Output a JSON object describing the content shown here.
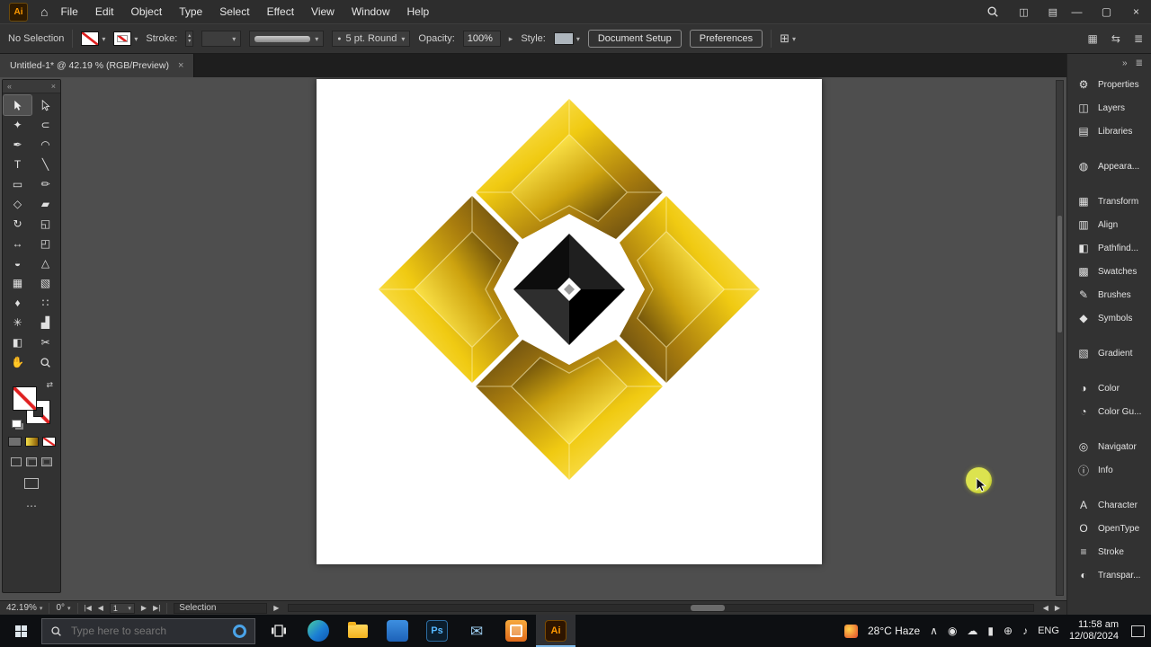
{
  "ui": {
    "chevron_down": "▾",
    "chevron_right": "▸",
    "grip": "᎒᎒"
  },
  "menu_bar": {
    "app_badge": "Ai",
    "home_icon": "⌂",
    "menus": [
      "File",
      "Edit",
      "Object",
      "Type",
      "Select",
      "Effect",
      "View",
      "Window",
      "Help"
    ],
    "arrange_icon": "◫",
    "workspace_icon": "▤",
    "minimize": "—",
    "restore": "▢",
    "close": "×"
  },
  "control_bar": {
    "selection_status": "No Selection",
    "stroke_label": "Stroke:",
    "spinner_up": "▴",
    "spinner_down": "▾",
    "brush_preset_bullet": "●",
    "brush_preset": "5 pt. Round",
    "opacity_label": "Opacity:",
    "opacity_value": "100%",
    "style_label": "Style:",
    "document_setup": "Document Setup",
    "preferences": "Preferences",
    "align_icon": "⊞",
    "right_icons": {
      "grid": "▦",
      "swap": "⇆",
      "menu": "≣"
    }
  },
  "document_tab": {
    "title": "Untitled-1* @ 42.19 % (RGB/Preview)",
    "close": "×"
  },
  "tools_panel": {
    "collapse_icon": "«",
    "close_icon": "×",
    "swap_icon": "⇄",
    "ellipsis": "⋯",
    "tools": [
      {
        "name": "selection",
        "glyph": ""
      },
      {
        "name": "direct-selection",
        "glyph": ""
      },
      {
        "name": "magic-wand",
        "glyph": "✦"
      },
      {
        "name": "lasso",
        "glyph": "⊂"
      },
      {
        "name": "pen",
        "glyph": "✒"
      },
      {
        "name": "curvature",
        "glyph": "◠"
      },
      {
        "name": "type",
        "glyph": "T"
      },
      {
        "name": "line-segment",
        "glyph": "╲"
      },
      {
        "name": "rectangle",
        "glyph": "▭"
      },
      {
        "name": "paintbrush",
        "glyph": "✏"
      },
      {
        "name": "shaper",
        "glyph": "◇"
      },
      {
        "name": "eraser",
        "glyph": "▰"
      },
      {
        "name": "rotate",
        "glyph": "↻"
      },
      {
        "name": "scale",
        "glyph": "◱"
      },
      {
        "name": "width",
        "glyph": "↔"
      },
      {
        "name": "free-transform",
        "glyph": "◰"
      },
      {
        "name": "shape-builder",
        "glyph": "◒"
      },
      {
        "name": "perspective-grid",
        "glyph": "△"
      },
      {
        "name": "mesh",
        "glyph": "▦"
      },
      {
        "name": "gradient",
        "glyph": "▧"
      },
      {
        "name": "eyedropper",
        "glyph": "♦"
      },
      {
        "name": "blend",
        "glyph": "∷"
      },
      {
        "name": "symbol-sprayer",
        "glyph": "✳"
      },
      {
        "name": "column-graph",
        "glyph": "▟"
      },
      {
        "name": "artboard",
        "glyph": "◧"
      },
      {
        "name": "slice",
        "glyph": "✂"
      },
      {
        "name": "hand",
        "glyph": "✋"
      },
      {
        "name": "zoom",
        "glyph": ""
      }
    ]
  },
  "right_panel": {
    "expand_icon": "»",
    "menu_icon": "≣",
    "items": [
      {
        "label": "Properties",
        "glyph": "⚙"
      },
      {
        "label": "Layers",
        "glyph": "◫"
      },
      {
        "label": "Libraries",
        "glyph": "▤"
      },
      {
        "label": "Appeara...",
        "glyph": "◍"
      },
      {
        "label": "Transform",
        "glyph": "▦"
      },
      {
        "label": "Align",
        "glyph": "▥"
      },
      {
        "label": "Pathfind...",
        "glyph": "◧"
      },
      {
        "label": "Swatches",
        "glyph": "▩"
      },
      {
        "label": "Brushes",
        "glyph": "✎"
      },
      {
        "label": "Symbols",
        "glyph": "◆"
      },
      {
        "label": "Gradient",
        "glyph": "▧"
      },
      {
        "label": "Color",
        "glyph": "◑"
      },
      {
        "label": "Color Gu...",
        "glyph": "◔"
      },
      {
        "label": "Navigator",
        "glyph": "◎"
      },
      {
        "label": "Info",
        "glyph": "ⓘ"
      },
      {
        "label": "Character",
        "glyph": "A"
      },
      {
        "label": "OpenType",
        "glyph": "O"
      },
      {
        "label": "Stroke",
        "glyph": "≡"
      },
      {
        "label": "Transpar...",
        "glyph": "◐"
      }
    ]
  },
  "status_bar": {
    "zoom": "42.19%",
    "rotation": "0°",
    "nav_first": "|◀",
    "nav_prev": "◀",
    "artboard_number": "1",
    "nav_next": "▶",
    "nav_last": "▶|",
    "mode": "Selection",
    "expand": "▶",
    "scroll_left": "◀",
    "scroll_right": "▶"
  },
  "taskbar": {
    "search_placeholder": "Type here to search",
    "apps": {
      "photoshop_text": "Ps",
      "illustrator_text": "Ai",
      "mail_glyph": "✉"
    },
    "weather_temp": "28°C",
    "weather_condition": "Haze",
    "tray_icons": {
      "hidden": "∧",
      "meet": "◉",
      "onedrive": "☁",
      "battery": "▮",
      "network": "⊕",
      "volume": "♪"
    },
    "language": "ENG",
    "time": "11:58 am",
    "date": "12/08/2024"
  },
  "artwork": {
    "gold_light": "#ffe96a",
    "gold_mid": "#f0ca12",
    "gold_dark": "#574012",
    "center_black": "#0c0c0c",
    "cursor_color": "#c9cf3a"
  }
}
